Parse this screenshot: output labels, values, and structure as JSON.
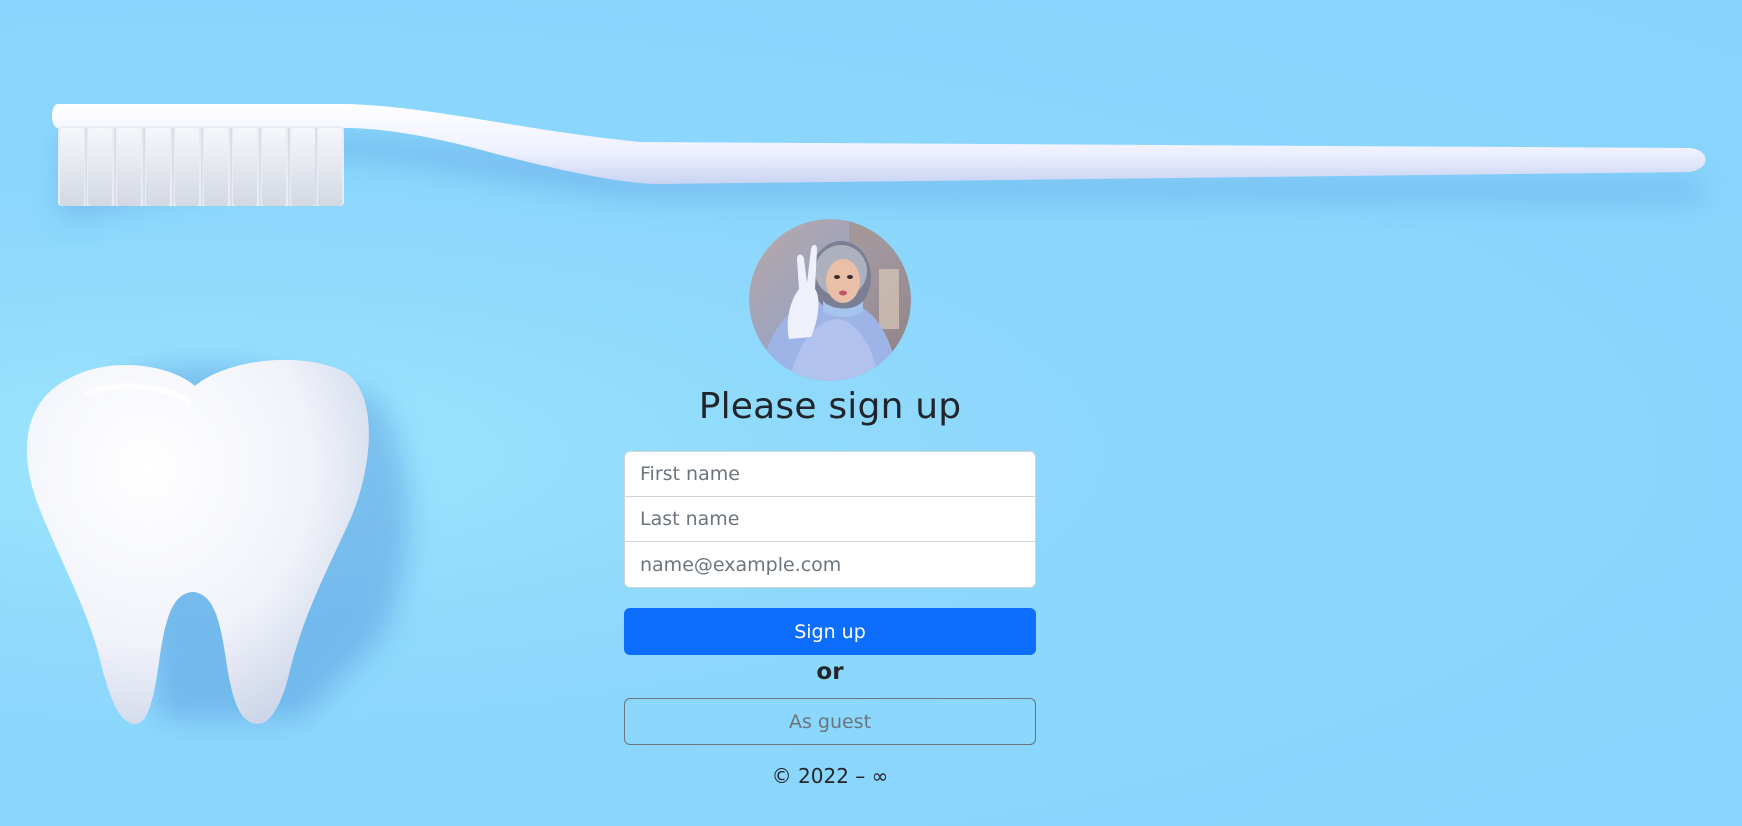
{
  "page": {
    "title": "Please sign up"
  },
  "form": {
    "first_name_placeholder": "First name",
    "last_name_placeholder": "Last name",
    "email_placeholder": "name@example.com",
    "signup_label": "Sign up",
    "or_label": "or",
    "guest_label": "As guest"
  },
  "footer": {
    "copyright": "© 2022 – ∞"
  },
  "colors": {
    "background": "#89d5fd",
    "primary_button": "#0d6efd",
    "secondary_outline": "#6c757d"
  }
}
